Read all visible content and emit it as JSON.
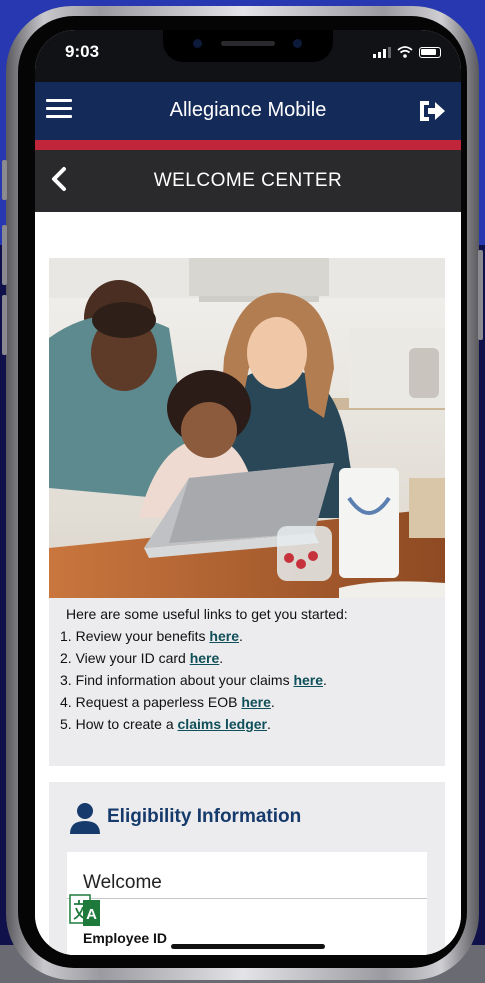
{
  "status_bar": {
    "time": "9:03"
  },
  "header": {
    "app_title": "Allegiance Mobile"
  },
  "sub_header": {
    "page_title": "WELCOME CENTER"
  },
  "welcome": {
    "intro": "Here are some useful links to get you started:",
    "links": [
      {
        "num": "1.",
        "text": "Review your benefits ",
        "link": "here",
        "after": "."
      },
      {
        "num": "2.",
        "text": "View your ID card ",
        "link": "here",
        "after": "."
      },
      {
        "num": "3.",
        "text": "Find information about your claims ",
        "link": "here",
        "after": "."
      },
      {
        "num": "4.",
        "text": "Request a paperless EOB ",
        "link": "here",
        "after": "."
      },
      {
        "num": "5.",
        "text": "How to create a ",
        "link": "claims ledger",
        "after": "."
      }
    ]
  },
  "eligibility": {
    "title": "Eligibility Information",
    "welcome_label": "Welcome",
    "employee_id_label": "Employee ID",
    "translate_icon_letter": "A"
  },
  "colors": {
    "header_bg": "#142a58",
    "accent_red": "#c0253a",
    "sub_header_bg": "#2a2a2c",
    "link_color": "#0f4f59",
    "section_title": "#173a6c"
  },
  "icons": {
    "menu": "hamburger-menu-icon",
    "logout": "sign-out-icon",
    "back": "chevron-left-icon",
    "user": "user-icon",
    "translate": "translate-icon"
  }
}
